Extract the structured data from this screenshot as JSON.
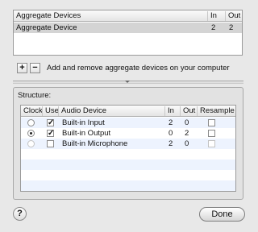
{
  "aggregate_table": {
    "headers": [
      "Aggregate Devices",
      "In",
      "Out"
    ],
    "rows": [
      {
        "name": "Aggregate Device",
        "in": "2",
        "out": "2"
      }
    ]
  },
  "toolbar": {
    "add_label": "+",
    "remove_label": "−",
    "hint": "Add and remove aggregate devices on your computer"
  },
  "structure": {
    "label": "Structure:",
    "headers": [
      "Clock",
      "Use",
      "Audio Device",
      "In",
      "Out",
      "Resample"
    ],
    "rows": [
      {
        "clock": false,
        "use": true,
        "device": "Built-in Input",
        "in": "2",
        "out": "0",
        "resample": false
      },
      {
        "clock": true,
        "use": true,
        "device": "Built-in Output",
        "in": "0",
        "out": "2",
        "resample": false
      },
      {
        "clock": false,
        "use": false,
        "device": "Built-in Microphone",
        "in": "2",
        "out": "0",
        "resample": false
      }
    ]
  },
  "footer": {
    "help_label": "?",
    "done_label": "Done"
  }
}
